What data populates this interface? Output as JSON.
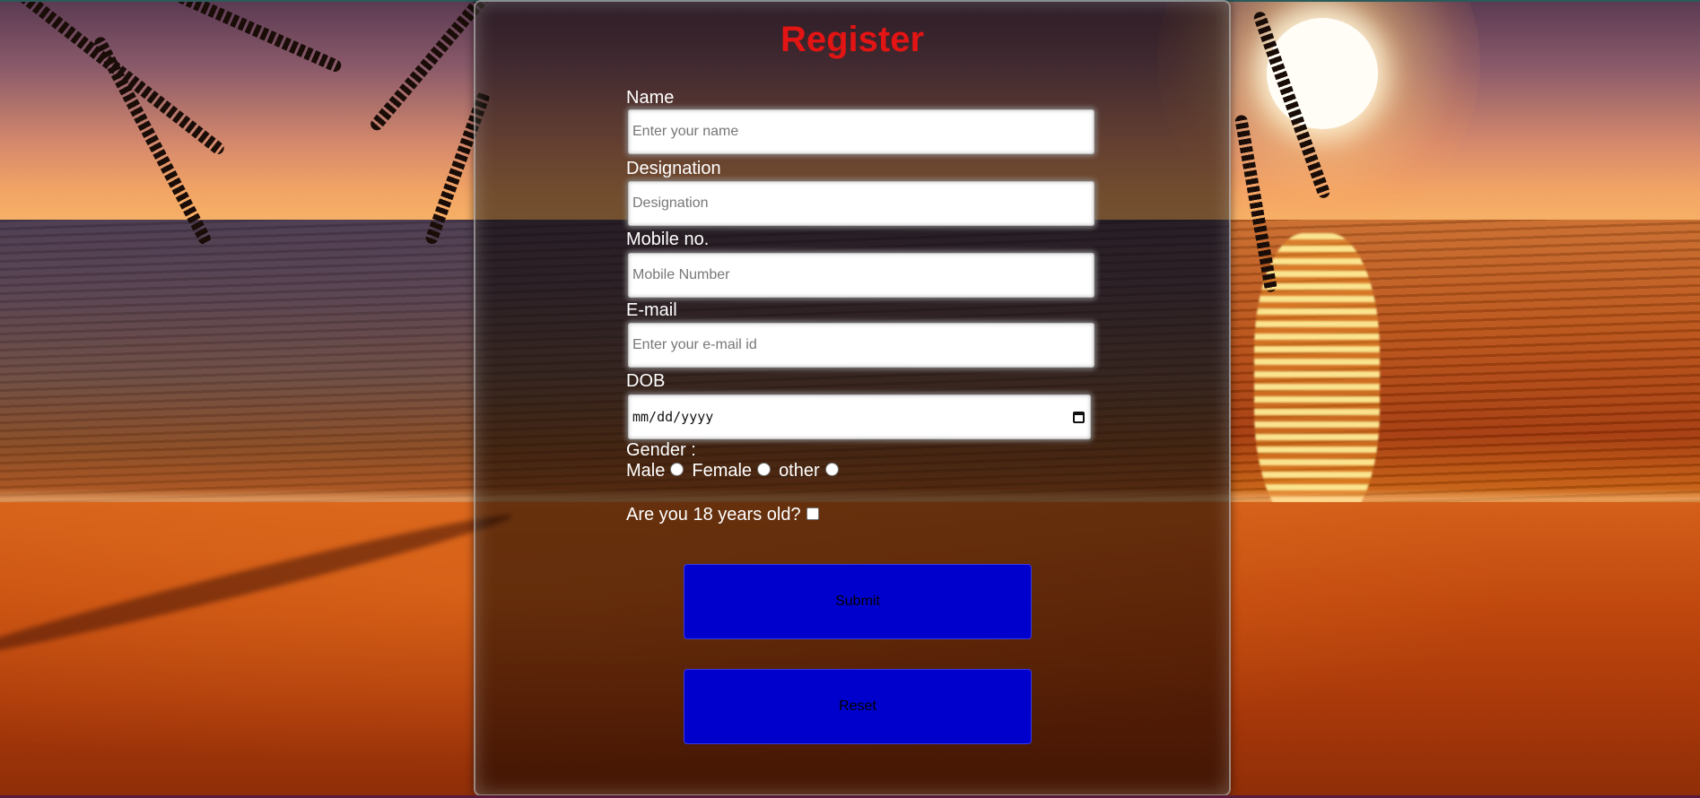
{
  "form": {
    "title": "Register",
    "name": {
      "label": "Name",
      "placeholder": "Enter your name",
      "value": ""
    },
    "designation": {
      "label": "Designation",
      "placeholder": "Designation",
      "value": ""
    },
    "mobile": {
      "label": "Mobile no.",
      "placeholder": "Mobile Number",
      "value": ""
    },
    "email": {
      "label": "E-mail",
      "placeholder": "Enter your e-mail id",
      "value": ""
    },
    "dob": {
      "label": "DOB",
      "placeholder": "mm/dd/yyyy"
    },
    "gender": {
      "label": "Gender :",
      "options": [
        "Male",
        "Female",
        "other"
      ],
      "selected": null
    },
    "age_check": {
      "label": "Are you 18 years old?",
      "checked": false
    },
    "submit_label": "Submit",
    "reset_label": "Reset"
  },
  "colors": {
    "title": "#e21414",
    "button_bg": "#0000cc",
    "label_text": "#ffffff"
  },
  "icons": {
    "date_picker": "calendar-icon"
  }
}
